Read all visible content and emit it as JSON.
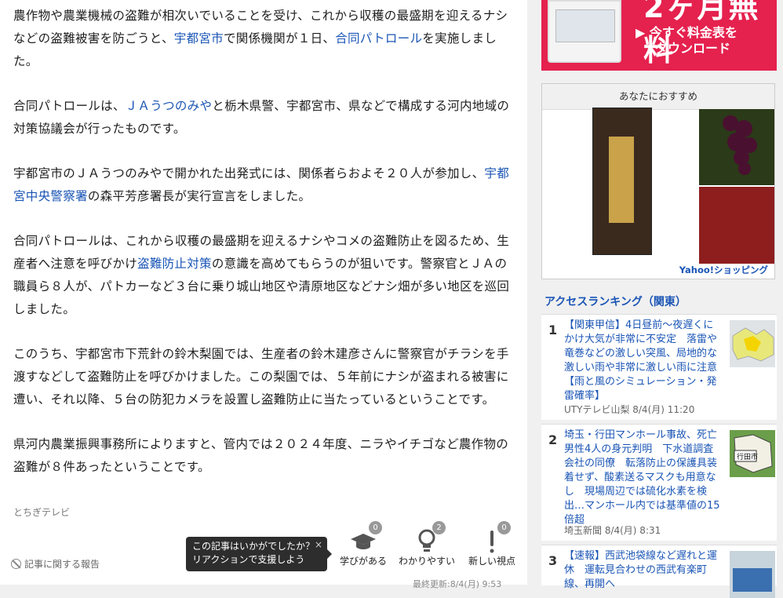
{
  "article": {
    "p1_a": "農作物や農業機械の盗難が相次いでいることを受け、これから収穫の最盛期を迎えるナシなどの盗難被害を防ごうと、",
    "p1_link1": "宇都宮市",
    "p1_b": "で関係機関が１日、",
    "p1_link2": "合同パトロール",
    "p1_c": "を実施しました。",
    "p2_a": "合同パトロールは、",
    "p2_link1": "ＪＡうつのみや",
    "p2_b": "と栃木県警、宇都宮市、県などで構成する河内地域の対策協議会が行ったものです。",
    "p3_a": "宇都宮市のＪＡうつのみやで開かれた出発式には、関係者らおよそ２０人が参加し、",
    "p3_link1": "宇都宮中央警察署",
    "p3_b": "の森平芳彦署長が実行宣言をしました。",
    "p4_a": "合同パトロールは、これから収穫の最盛期を迎えるナシやコメの盗難防止を図るため、生産者へ注意を呼びかけ",
    "p4_link1": "盗難防止対策",
    "p4_b": "の意識を高めてもらうのが狙いです。警察官とＪＡの職員ら８人が、パトカーなど３台に乗り城山地区や清原地区などナシ畑が多い地区を巡回しました。",
    "p5": "このうち、宇都宮市下荒針の鈴木梨園では、生産者の鈴木建彦さんに警察官がチラシを手渡すなどして盗難防止を呼びかけました。この梨園では、５年前にナシが盗まれる被害に遭い、それ以降、５台の防犯カメラを設置し盗難防止に当たっているということです。",
    "p6": "県河内農業振興事務所によりますと、管内では２０２４年度、ニラやイチゴなど農作物の盗難が８件あったということです。",
    "source": "とちぎテレビ",
    "report": "記事に関する報告",
    "updated": "最終更新:8/4(月) 9:53"
  },
  "tooltip": {
    "line1": "この記事はいかがでしたか？",
    "line2": "リアクションで支援しよう",
    "close": "×"
  },
  "reactions": [
    {
      "label": "学びがある",
      "count": "0",
      "icon": "mortarboard-icon"
    },
    {
      "label": "わかりやすい",
      "count": "2",
      "icon": "lightbulb-icon"
    },
    {
      "label": "新しい視点",
      "count": "0",
      "icon": "exclamation-icon"
    }
  ],
  "ad": {
    "big": "2ヶ月無料",
    "line1": "▶ 今すぐ料金表を",
    "line2": "ダウンロード",
    "color": "#e5214e"
  },
  "recommend": {
    "title": "あなたにおすすめ",
    "shop": "Yahoo!ショッピング"
  },
  "ranking": {
    "title": "アクセスランキング（関東）",
    "items": [
      {
        "num": "1",
        "text": "【関東甲信】4日昼前～夜遅くにかけ大気が非常に不安定　落雷や竜巻などの激しい突風、局地的な激しい雨や非常に激しい雨に注意【雨と風のシミュレーション・発雷確率】",
        "meta": "UTYテレビ山梨 8/4(月) 11:20"
      },
      {
        "num": "2",
        "text": "埼玉・行田マンホール事故、死亡男性4人の身元判明　下水道調査会社の同僚　転落防止の保護具装着せず、酸素送るマスクも用意なし　現場周辺では硫化水素を検出…マンホール内では基準値の15倍超",
        "meta": "埼玉新聞 8/4(月) 8:31",
        "thumb_label": "行田市"
      },
      {
        "num": "3",
        "text": "【速報】西武池袋線など遅れと運休　運転見合わせの西武有楽町線、再開へ",
        "meta": ""
      }
    ]
  }
}
